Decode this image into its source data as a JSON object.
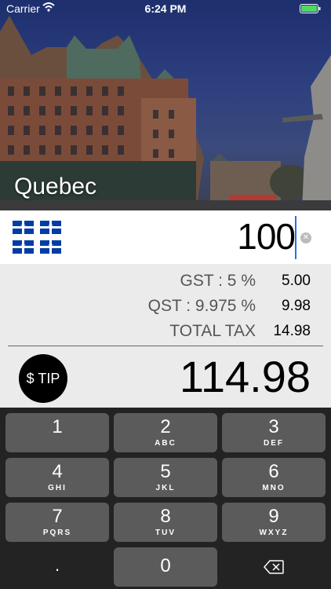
{
  "status_bar": {
    "carrier": "Carrier",
    "time": "6:24 PM"
  },
  "hero": {
    "city_name": "Quebec"
  },
  "input": {
    "amount": "100"
  },
  "taxes": [
    {
      "label": "GST : 5 %",
      "value": "5.00"
    },
    {
      "label": "QST : 9.975 %",
      "value": "9.98"
    },
    {
      "label": "TOTAL TAX",
      "value": "14.98"
    }
  ],
  "tip_button_label": "$ TIP",
  "total": "114.98",
  "keypad": {
    "keys": [
      {
        "digit": "1",
        "letters": ""
      },
      {
        "digit": "2",
        "letters": "ABC"
      },
      {
        "digit": "3",
        "letters": "DEF"
      },
      {
        "digit": "4",
        "letters": "GHI"
      },
      {
        "digit": "5",
        "letters": "JKL"
      },
      {
        "digit": "6",
        "letters": "MNO"
      },
      {
        "digit": "7",
        "letters": "PQRS"
      },
      {
        "digit": "8",
        "letters": "TUV"
      },
      {
        "digit": "9",
        "letters": "WXYZ"
      },
      {
        "digit": ".",
        "letters": ""
      },
      {
        "digit": "0",
        "letters": ""
      }
    ]
  },
  "icons": {
    "flag_glyph": "⚜",
    "clear_glyph": "✕",
    "wifi_glyph": "◠"
  },
  "colors": {
    "flag_blue": "#003da5",
    "cursor": "#2a6cf0",
    "battery": "#4cd964"
  }
}
